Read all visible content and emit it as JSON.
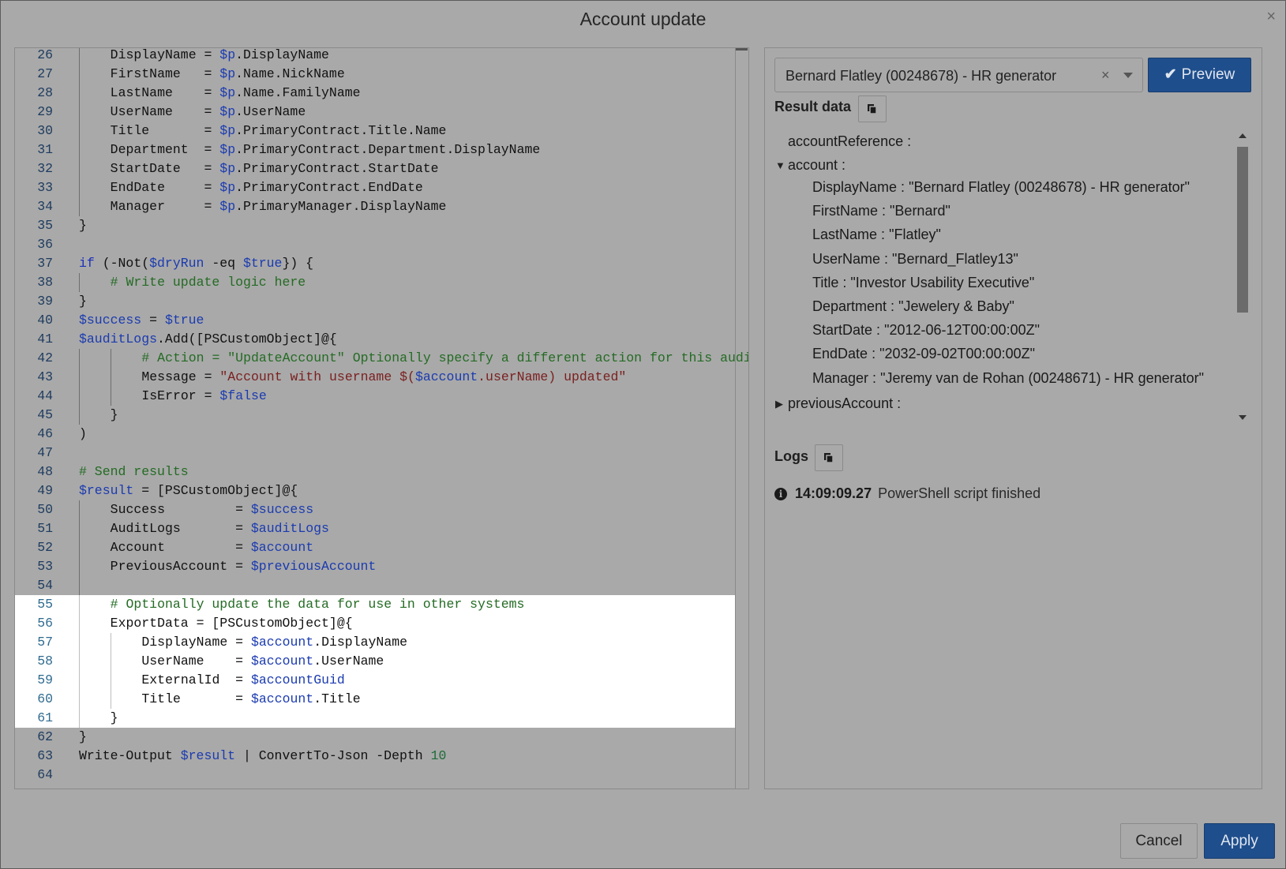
{
  "dialog": {
    "title": "Account update",
    "close_symbol": "×"
  },
  "editor": {
    "lines": [
      {
        "n": "26",
        "indent": 1,
        "tokens": [
          [
            "",
            "DisplayName = "
          ],
          [
            "var",
            "$p"
          ],
          [
            "",
            ".DisplayName"
          ]
        ]
      },
      {
        "n": "27",
        "indent": 1,
        "tokens": [
          [
            "",
            "FirstName   = "
          ],
          [
            "var",
            "$p"
          ],
          [
            "",
            ".Name.NickName"
          ]
        ]
      },
      {
        "n": "28",
        "indent": 1,
        "tokens": [
          [
            "",
            "LastName    = "
          ],
          [
            "var",
            "$p"
          ],
          [
            "",
            ".Name.FamilyName"
          ]
        ]
      },
      {
        "n": "29",
        "indent": 1,
        "tokens": [
          [
            "",
            "UserName    = "
          ],
          [
            "var",
            "$p"
          ],
          [
            "",
            ".UserName"
          ]
        ]
      },
      {
        "n": "30",
        "indent": 1,
        "tokens": [
          [
            "",
            "Title       = "
          ],
          [
            "var",
            "$p"
          ],
          [
            "",
            ".PrimaryContract.Title.Name"
          ]
        ]
      },
      {
        "n": "31",
        "indent": 1,
        "tokens": [
          [
            "",
            "Department  = "
          ],
          [
            "var",
            "$p"
          ],
          [
            "",
            ".PrimaryContract.Department.DisplayName"
          ]
        ]
      },
      {
        "n": "32",
        "indent": 1,
        "tokens": [
          [
            "",
            "StartDate   = "
          ],
          [
            "var",
            "$p"
          ],
          [
            "",
            ".PrimaryContract.StartDate"
          ]
        ]
      },
      {
        "n": "33",
        "indent": 1,
        "tokens": [
          [
            "",
            "EndDate     = "
          ],
          [
            "var",
            "$p"
          ],
          [
            "",
            ".PrimaryContract.EndDate"
          ]
        ]
      },
      {
        "n": "34",
        "indent": 1,
        "tokens": [
          [
            "",
            "Manager     = "
          ],
          [
            "var",
            "$p"
          ],
          [
            "",
            ".PrimaryManager.DisplayName"
          ]
        ]
      },
      {
        "n": "35",
        "indent": 0,
        "tokens": [
          [
            "",
            "}"
          ]
        ]
      },
      {
        "n": "36",
        "indent": 0,
        "tokens": []
      },
      {
        "n": "37",
        "indent": 0,
        "tokens": [
          [
            "kw",
            "if"
          ],
          [
            "",
            " (-Not("
          ],
          [
            "var",
            "$dryRun"
          ],
          [
            "",
            " -eq "
          ],
          [
            "var",
            "$true"
          ],
          [
            "",
            "}) {"
          ]
        ]
      },
      {
        "n": "38",
        "indent": 1,
        "tokens": [
          [
            "com",
            "# Write update logic here"
          ]
        ]
      },
      {
        "n": "39",
        "indent": 0,
        "tokens": [
          [
            "",
            "}"
          ]
        ]
      },
      {
        "n": "40",
        "indent": 0,
        "tokens": [
          [
            "var",
            "$success"
          ],
          [
            "",
            " = "
          ],
          [
            "var",
            "$true"
          ]
        ]
      },
      {
        "n": "41",
        "indent": 0,
        "tokens": [
          [
            "var",
            "$auditLogs"
          ],
          [
            "",
            ".Add([PSCustomObject]@{"
          ]
        ]
      },
      {
        "n": "42",
        "indent": 2,
        "tokens": [
          [
            "com",
            "# Action = \"UpdateAccount\" Optionally specify a different action for this audit log"
          ]
        ]
      },
      {
        "n": "43",
        "indent": 2,
        "tokens": [
          [
            "",
            "Message = "
          ],
          [
            "str",
            "\"Account with username $("
          ],
          [
            "var",
            "$account"
          ],
          [
            "str",
            ".userName) updated\""
          ]
        ]
      },
      {
        "n": "44",
        "indent": 2,
        "tokens": [
          [
            "",
            "IsError = "
          ],
          [
            "var",
            "$false"
          ]
        ]
      },
      {
        "n": "45",
        "indent": 1,
        "tokens": [
          [
            "",
            "}"
          ]
        ]
      },
      {
        "n": "46",
        "indent": 0,
        "tokens": [
          [
            "",
            ")"
          ]
        ]
      },
      {
        "n": "47",
        "indent": 0,
        "tokens": []
      },
      {
        "n": "48",
        "indent": 0,
        "tokens": [
          [
            "com",
            "# Send results"
          ]
        ]
      },
      {
        "n": "49",
        "indent": 0,
        "tokens": [
          [
            "var",
            "$result"
          ],
          [
            "",
            " = [PSCustomObject]@{"
          ]
        ]
      },
      {
        "n": "50",
        "indent": 1,
        "tokens": [
          [
            "",
            "Success         = "
          ],
          [
            "var",
            "$success"
          ]
        ]
      },
      {
        "n": "51",
        "indent": 1,
        "tokens": [
          [
            "",
            "AuditLogs       = "
          ],
          [
            "var",
            "$auditLogs"
          ]
        ]
      },
      {
        "n": "52",
        "indent": 1,
        "tokens": [
          [
            "",
            "Account         = "
          ],
          [
            "var",
            "$account"
          ]
        ]
      },
      {
        "n": "53",
        "indent": 1,
        "tokens": [
          [
            "",
            "PreviousAccount = "
          ],
          [
            "var",
            "$previousAccount"
          ]
        ]
      },
      {
        "n": "54",
        "indent": 1,
        "tokens": []
      },
      {
        "n": "55",
        "indent": 1,
        "hl": true,
        "tokens": [
          [
            "com",
            "# Optionally update the data for use in other systems"
          ]
        ]
      },
      {
        "n": "56",
        "indent": 1,
        "hl": true,
        "tokens": [
          [
            "",
            "ExportData = [PSCustomObject]@{"
          ]
        ]
      },
      {
        "n": "57",
        "indent": 2,
        "hl": true,
        "tokens": [
          [
            "",
            "DisplayName = "
          ],
          [
            "var",
            "$account"
          ],
          [
            "",
            ".DisplayName"
          ]
        ]
      },
      {
        "n": "58",
        "indent": 2,
        "hl": true,
        "tokens": [
          [
            "",
            "UserName    = "
          ],
          [
            "var",
            "$account"
          ],
          [
            "",
            ".UserName"
          ]
        ]
      },
      {
        "n": "59",
        "indent": 2,
        "hl": true,
        "tokens": [
          [
            "",
            "ExternalId  = "
          ],
          [
            "var",
            "$accountGuid"
          ]
        ]
      },
      {
        "n": "60",
        "indent": 2,
        "hl": true,
        "tokens": [
          [
            "",
            "Title       = "
          ],
          [
            "var",
            "$account"
          ],
          [
            "",
            ".Title"
          ]
        ]
      },
      {
        "n": "61",
        "indent": 1,
        "hl": true,
        "tokens": [
          [
            "",
            "}"
          ]
        ]
      },
      {
        "n": "62",
        "indent": 0,
        "tokens": [
          [
            "",
            "}"
          ]
        ]
      },
      {
        "n": "63",
        "indent": 0,
        "tokens": [
          [
            "",
            "Write-Output "
          ],
          [
            "var",
            "$result"
          ],
          [
            "",
            " | ConvertTo-Json -Depth "
          ],
          [
            "num",
            "10"
          ]
        ]
      },
      {
        "n": "64",
        "indent": 0,
        "tokens": []
      }
    ]
  },
  "person_select": {
    "value": "Bernard Flatley (00248678) - HR generator",
    "clear_symbol": "×"
  },
  "preview_button": {
    "check": "✔",
    "label": "Preview"
  },
  "result_data": {
    "title": "Result data",
    "account_reference": "accountReference :",
    "account_label": "account :",
    "account_expanded_arrow": "▼",
    "fields": [
      {
        "key": "DisplayName",
        "value": "\"Bernard Flatley (00248678) - HR generator\""
      },
      {
        "key": "FirstName",
        "value": "\"Bernard\""
      },
      {
        "key": "LastName",
        "value": "\"Flatley\""
      },
      {
        "key": "UserName",
        "value": "\"Bernard_Flatley13\""
      },
      {
        "key": "Title",
        "value": "\"Investor Usability Executive\""
      },
      {
        "key": "Department",
        "value": "\"Jewelery & Baby\""
      },
      {
        "key": "StartDate",
        "value": "\"2012-06-12T00:00:00Z\""
      },
      {
        "key": "EndDate",
        "value": "\"2032-09-02T00:00:00Z\""
      },
      {
        "key": "Manager",
        "value": "\"Jeremy van de Rohan (00248671) - HR generator\""
      }
    ],
    "previous_account_label": "previousAccount :",
    "previous_collapsed_arrow": "▶"
  },
  "logs": {
    "title": "Logs",
    "icon_glyph": "i",
    "entries": [
      {
        "time": "14:09:09.27",
        "message": "PowerShell script finished"
      }
    ]
  },
  "footer": {
    "cancel_label": "Cancel",
    "apply_label": "Apply"
  },
  "colors": {
    "background": "#a9a9a9",
    "accent": "#1f4e8c",
    "highlight": "#ffffff"
  }
}
